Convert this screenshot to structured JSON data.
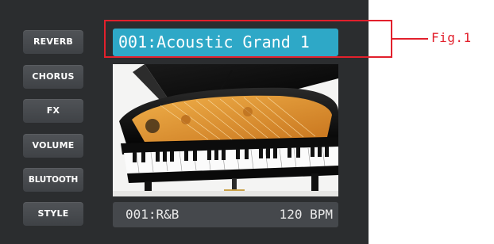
{
  "side_buttons": [
    {
      "label": "REVERB"
    },
    {
      "label": "CHORUS"
    },
    {
      "label": "FX"
    },
    {
      "label": "VOLUME"
    },
    {
      "label": "BLUTOOTH"
    },
    {
      "label": "STYLE"
    }
  ],
  "voice": {
    "name": "001:Acoustic Grand 1"
  },
  "status": {
    "style": "001:R&B",
    "tempo": "120 BPM"
  },
  "annotation": {
    "label": "Fig.1"
  },
  "colors": {
    "screen_bg": "#2b2d2f",
    "button_bg": "#4a4d51",
    "voice_highlight": "#2ea8c7",
    "status_bg": "#45484c",
    "callout": "#e2202c"
  },
  "icons": {
    "instrument_image": "grand-piano-image"
  }
}
